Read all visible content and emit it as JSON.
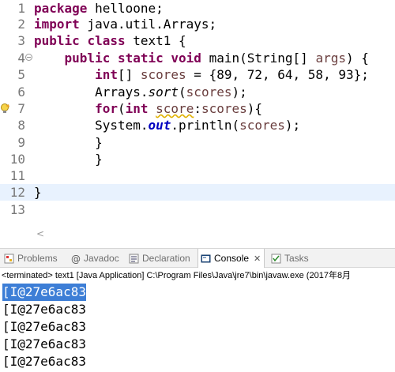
{
  "editor": {
    "lines": [
      {
        "num": "1",
        "tokens": [
          {
            "t": "package",
            "c": "kw"
          },
          {
            "t": " helloone;",
            "c": ""
          }
        ]
      },
      {
        "num": "2",
        "tokens": [
          {
            "t": "import",
            "c": "kw"
          },
          {
            "t": " java.util.Arrays;",
            "c": ""
          }
        ]
      },
      {
        "num": "3",
        "tokens": [
          {
            "t": "public",
            "c": "kw"
          },
          {
            "t": " ",
            "c": ""
          },
          {
            "t": "class",
            "c": "kw"
          },
          {
            "t": " text1 {",
            "c": ""
          }
        ]
      },
      {
        "num": "4",
        "fold": true,
        "tokens": [
          {
            "t": "    ",
            "c": ""
          },
          {
            "t": "public",
            "c": "kw"
          },
          {
            "t": " ",
            "c": ""
          },
          {
            "t": "static",
            "c": "kw"
          },
          {
            "t": " ",
            "c": ""
          },
          {
            "t": "void",
            "c": "kw"
          },
          {
            "t": " main(String[] ",
            "c": ""
          },
          {
            "t": "args",
            "c": "field"
          },
          {
            "t": ") {",
            "c": ""
          }
        ]
      },
      {
        "num": "5",
        "tokens": [
          {
            "t": "        ",
            "c": ""
          },
          {
            "t": "int",
            "c": "kw"
          },
          {
            "t": "[] ",
            "c": ""
          },
          {
            "t": "scores",
            "c": "field"
          },
          {
            "t": " = {89, 72, 64, 58, 93};",
            "c": ""
          }
        ]
      },
      {
        "num": "6",
        "tokens": [
          {
            "t": "        Arrays.",
            "c": ""
          },
          {
            "t": "sort",
            "c": "static-ref"
          },
          {
            "t": "(",
            "c": ""
          },
          {
            "t": "scores",
            "c": "field"
          },
          {
            "t": ");",
            "c": ""
          }
        ]
      },
      {
        "num": "7",
        "warning": true,
        "tokens": [
          {
            "t": "        ",
            "c": ""
          },
          {
            "t": "for",
            "c": "kw"
          },
          {
            "t": "(",
            "c": ""
          },
          {
            "t": "int",
            "c": "kw"
          },
          {
            "t": " ",
            "c": ""
          },
          {
            "t": "score",
            "c": "field squiggle"
          },
          {
            "t": ":",
            "c": ""
          },
          {
            "t": "scores",
            "c": "field"
          },
          {
            "t": "){",
            "c": ""
          }
        ]
      },
      {
        "num": "8",
        "tokens": [
          {
            "t": "        System.",
            "c": ""
          },
          {
            "t": "out",
            "c": "static-field"
          },
          {
            "t": ".println(",
            "c": ""
          },
          {
            "t": "scores",
            "c": "field"
          },
          {
            "t": ");",
            "c": ""
          }
        ]
      },
      {
        "num": "9",
        "tokens": [
          {
            "t": "        }",
            "c": ""
          }
        ]
      },
      {
        "num": "10",
        "tokens": [
          {
            "t": "        }",
            "c": ""
          }
        ]
      },
      {
        "num": "11",
        "tokens": []
      },
      {
        "num": "12",
        "highlight": true,
        "tokens": [
          {
            "t": "}",
            "c": ""
          }
        ]
      },
      {
        "num": "13",
        "tokens": []
      }
    ],
    "scroll_left_glyph": "<"
  },
  "views": {
    "tabs": [
      {
        "label": "Problems",
        "icon": "problems-icon",
        "active": false
      },
      {
        "label": "Javadoc",
        "icon": "javadoc-icon",
        "active": false
      },
      {
        "label": "Declaration",
        "icon": "declaration-icon",
        "active": false
      },
      {
        "label": "Console",
        "icon": "console-icon",
        "active": true
      },
      {
        "label": "Tasks",
        "icon": "tasks-icon",
        "active": false
      }
    ],
    "close_glyph": "✕"
  },
  "console": {
    "header": "<terminated> text1 [Java Application] C:\\Program Files\\Java\\jre7\\bin\\javaw.exe (2017年8月",
    "output": [
      "[I@27e6ac83",
      "[I@27e6ac83",
      "[I@27e6ac83",
      "[I@27e6ac83",
      "[I@27e6ac83"
    ],
    "selected_index": 0
  },
  "colors": {
    "keyword": "#7f0055",
    "field": "#6a3e3e",
    "static_field": "#0000c0",
    "selection": "#3d7ed6",
    "current_line": "#e8f2fe"
  }
}
